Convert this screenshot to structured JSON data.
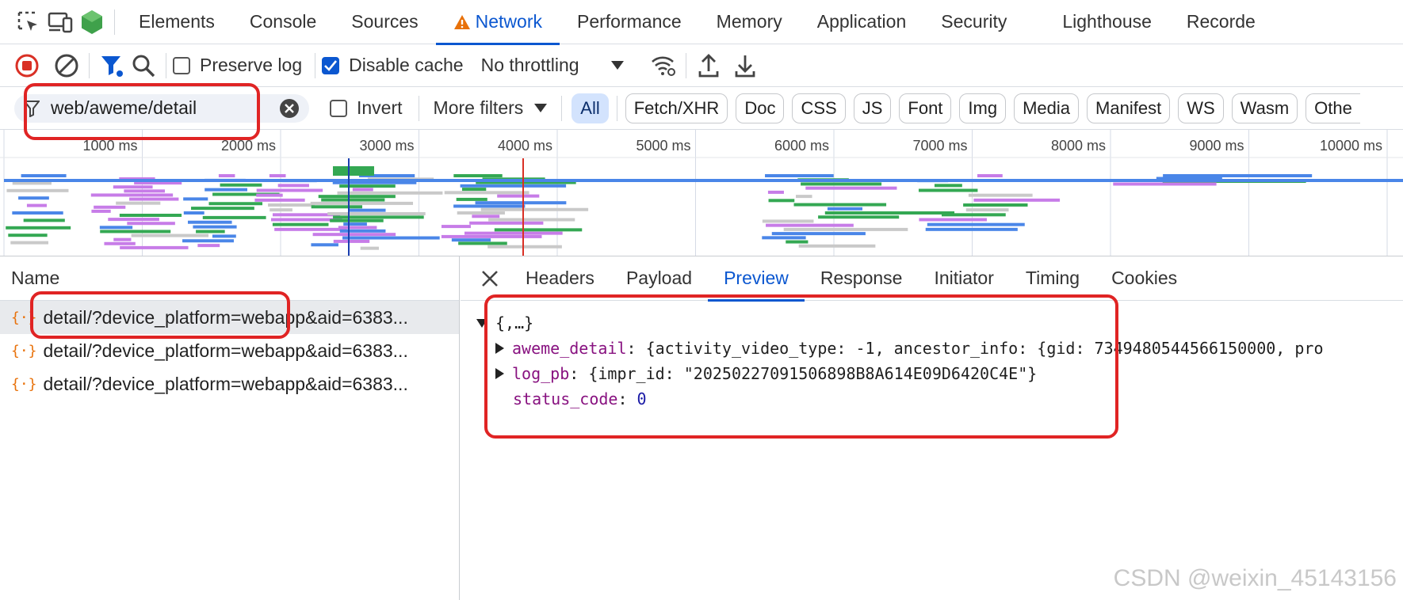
{
  "tabs": [
    "Elements",
    "Console",
    "Sources",
    "Network",
    "Performance",
    "Memory",
    "Application",
    "Security",
    "Lighthouse",
    "Recorde"
  ],
  "toolbar": {
    "preserve_log": "Preserve log",
    "disable_cache": "Disable cache",
    "throttling": "No throttling"
  },
  "filter": {
    "value": "web/aweme/detail",
    "invert": "Invert",
    "more_filters": "More filters",
    "types": [
      "All",
      "Fetch/XHR",
      "Doc",
      "CSS",
      "JS",
      "Font",
      "Img",
      "Media",
      "Manifest",
      "WS",
      "Wasm",
      "Othe"
    ]
  },
  "timeline": {
    "ticks": [
      "1000 ms",
      "2000 ms",
      "3000 ms",
      "4000 ms",
      "5000 ms",
      "6000 ms",
      "7000 ms",
      "8000 ms",
      "9000 ms",
      "10000 ms"
    ]
  },
  "requests": {
    "header": "Name",
    "rows": [
      "detail/?device_platform=webapp&aid=6383...",
      "detail/?device_platform=webapp&aid=6383...",
      "detail/?device_platform=webapp&aid=6383..."
    ]
  },
  "detail": {
    "tabs": [
      "Headers",
      "Payload",
      "Preview",
      "Response",
      "Initiator",
      "Timing",
      "Cookies"
    ],
    "root": "{,…}",
    "lines": [
      {
        "key": "aweme_detail",
        "value": "{activity_video_type: -1, ancestor_info: {gid: 7349480544566150000, pro"
      },
      {
        "key": "log_pb",
        "value": "{impr_id: \"20250227091506898B8A614E09D6420C4E\"}"
      },
      {
        "key": "status_code",
        "value": "0"
      }
    ]
  },
  "watermark": "CSDN @weixin_45143156",
  "colors": {
    "accent": "#0b57d0",
    "highlight": "#e02424",
    "json_key": "#881280"
  }
}
